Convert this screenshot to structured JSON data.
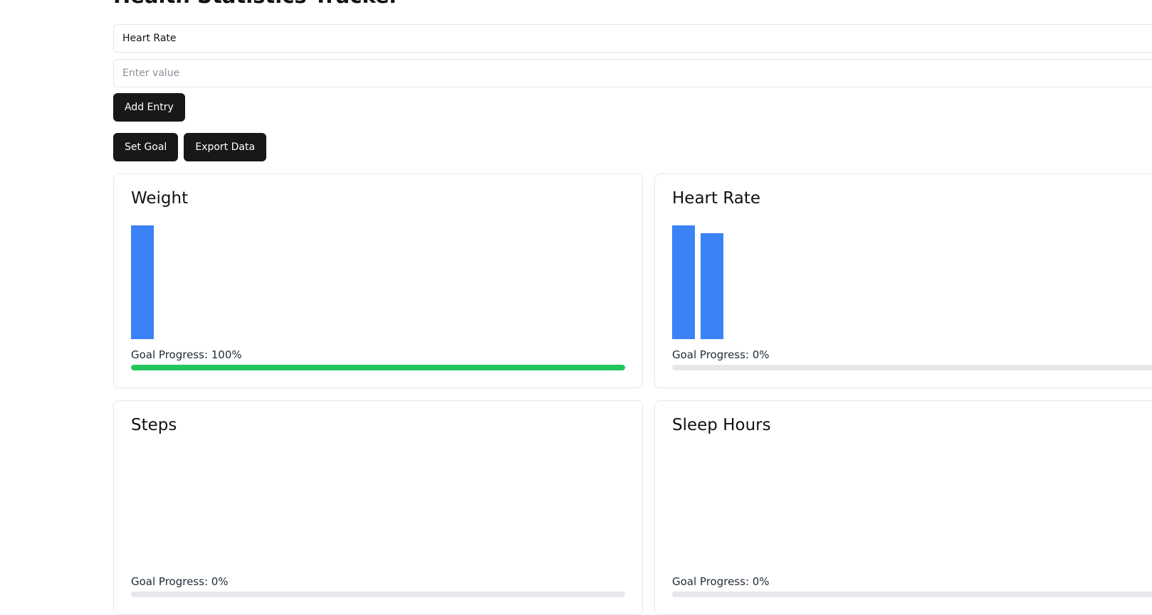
{
  "app": {
    "title": "Health Statistics Tracker"
  },
  "form": {
    "metric_select_value": "Heart Rate",
    "value_input_placeholder": "Enter value",
    "add_entry_label": "Add Entry"
  },
  "actions": {
    "set_goal_label": "Set Goal",
    "export_data_label": "Export Data"
  },
  "colors": {
    "bar": "#3b82f6",
    "progress_fill": "#22c55e",
    "progress_track": "#e5e7eb",
    "button_bg": "#18181b"
  },
  "cards": [
    {
      "title": "Weight",
      "goal_progress_label": "Goal Progress: 100%",
      "goal_progress": 1.0
    },
    {
      "title": "Heart Rate",
      "goal_progress_label": "Goal Progress: 0%",
      "goal_progress": 0.0
    },
    {
      "title": "Steps",
      "goal_progress_label": "Goal Progress: 0%",
      "goal_progress": 0.0
    },
    {
      "title": "Sleep Hours",
      "goal_progress_label": "Goal Progress: 0%",
      "goal_progress": 0.0
    }
  ],
  "chart_data": [
    {
      "type": "bar",
      "series": [
        {
          "values": [
            1.0
          ]
        }
      ]
    },
    {
      "type": "bar",
      "series": [
        {
          "values": [
            1.0,
            0.93
          ]
        }
      ]
    },
    {
      "type": "bar",
      "series": [
        {
          "values": []
        }
      ]
    },
    {
      "type": "bar",
      "series": [
        {
          "values": []
        }
      ]
    }
  ]
}
